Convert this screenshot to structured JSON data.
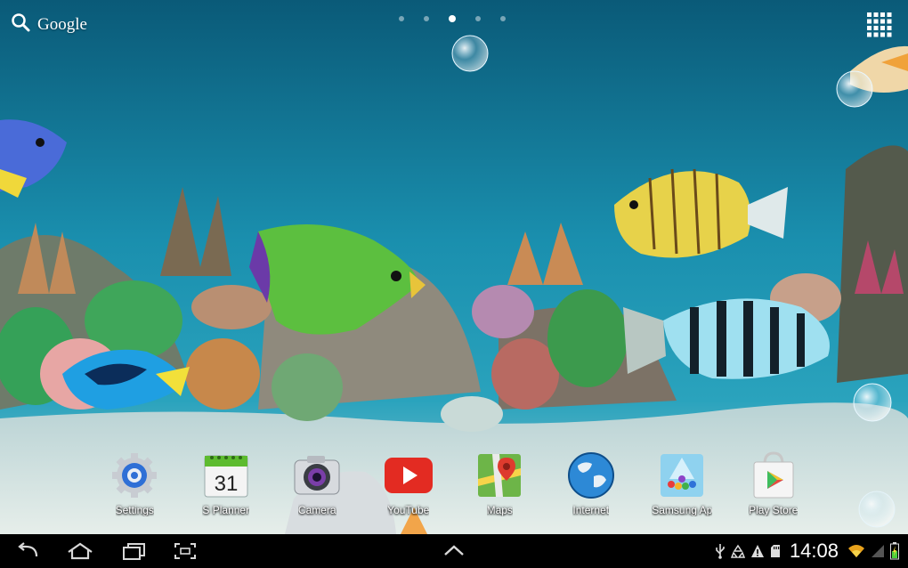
{
  "search": {
    "label": "Google",
    "icon": "search-icon"
  },
  "pages": {
    "count": 5,
    "active_index": 2
  },
  "apps_button": {
    "icon": "apps-grid-icon"
  },
  "dock": [
    {
      "label": "Settings",
      "icon": "settings-icon"
    },
    {
      "label": "S Planner",
      "icon": "calendar-icon",
      "day": "31"
    },
    {
      "label": "Camera",
      "icon": "camera-icon"
    },
    {
      "label": "YouTube",
      "icon": "youtube-icon"
    },
    {
      "label": "Maps",
      "icon": "maps-icon"
    },
    {
      "label": "Internet",
      "icon": "globe-icon"
    },
    {
      "label": "Samsung Ap",
      "icon": "samsung-apps-icon"
    },
    {
      "label": "Play Store",
      "icon": "play-store-icon"
    }
  ],
  "navbar": {
    "back": "back-icon",
    "home": "home-icon",
    "recent": "recent-apps-icon",
    "screenshot": "screen-capture-icon",
    "up": "chevron-up-icon"
  },
  "status": {
    "time": "14:08",
    "icons": [
      "usb-icon",
      "recycle-icon",
      "warning-icon",
      "sd-card-icon",
      "wifi-icon",
      "signal-icon",
      "battery-icon"
    ]
  },
  "colors": {
    "water_top": "#0a5c78",
    "water_mid": "#1a8eab",
    "sand": "#d9e4e3",
    "navbar": "#000000"
  }
}
